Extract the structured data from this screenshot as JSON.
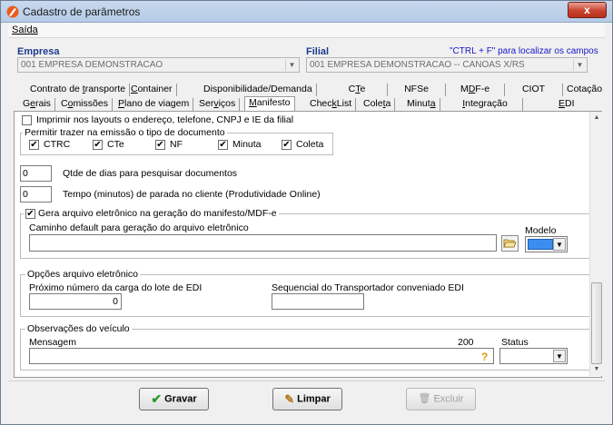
{
  "window": {
    "title": "Cadastro de parâmetros",
    "close_label": "x"
  },
  "menu": {
    "saida": "Saída"
  },
  "empresa": {
    "label": "Empresa",
    "value": "001 EMPRESA DEMONSTRACAO"
  },
  "filial": {
    "label": "Filial",
    "value": "001 EMPRESA DEMONSTRACAO -- CANOAS X/RS",
    "hint": "\"CTRL + F\" para localizar os campos"
  },
  "tabs_row1": [
    "Contrato de transporte",
    "Container",
    "Disponibilidade/Demanda",
    "CTe",
    "NFSe",
    "MDF-e",
    "CIOT",
    "Cotação"
  ],
  "tabs_row2": [
    "Gerais",
    "Comissões",
    "Plano de viagem",
    "Serviços",
    "Manifesto",
    "CheckList",
    "Coleta",
    "Minuta",
    "Integração",
    "EDI"
  ],
  "active_tab": "Manifesto",
  "form": {
    "imprimir_label": "Imprimir nos layouts o endereço, telefone, CNPJ e IE da filial",
    "permitir_legend": "Permitir trazer na emissão o tipo de documento",
    "doc_types": [
      "CTRC",
      "CTe",
      "NF",
      "Minuta",
      "Coleta"
    ],
    "qtde_value": "0",
    "qtde_label": "Qtde de dias para pesquisar documentos",
    "tempo_value": "0",
    "tempo_label": "Tempo (minutos) de parada no cliente (Produtividade Online)",
    "gera_legend": "Gera arquivo eletrônico na geração do manifesto/MDF-e",
    "caminho_label": "Caminho default para geração do arquivo eletrônico",
    "caminho_value": "",
    "modelo_label": "Modelo",
    "opcoes_legend": "Opções arquivo eletrônico",
    "proximo_label": "Próximo número da carga do lote de EDI",
    "proximo_value": "0",
    "sequencial_label": "Sequencial do Transportador conveniado EDI",
    "sequencial_value": "",
    "observacoes_legend": "Observações do veículo",
    "mensagem_label": "Mensagem",
    "mensagem_count": "200",
    "mensagem_value": "",
    "help_glyph": "?",
    "status_label": "Status",
    "status_value": ""
  },
  "buttons": {
    "gravar": "Gravar",
    "limpar": "Limpar",
    "excluir": "Excluir"
  },
  "colors": {
    "accent_blue": "#1b3b8b",
    "hint_blue": "#1818c8",
    "modelo_swatch": "#3c8df0"
  }
}
